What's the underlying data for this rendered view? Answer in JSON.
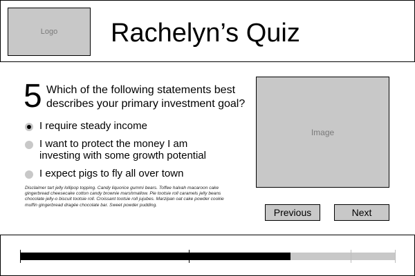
{
  "header": {
    "logo_label": "Logo",
    "title": "Rachelyn’s Quiz"
  },
  "question": {
    "number": "5",
    "text": "Which of the following statements best describes your primary investment goal?",
    "options": [
      {
        "label": "I require steady income",
        "selected": true
      },
      {
        "label": "I want to protect the money I am investing with some growth potential",
        "selected": false
      },
      {
        "label": "I expect pigs to fly all over town",
        "selected": false
      }
    ],
    "disclaimer": "Disclaimer tart jelly lollipop topping. Candy liquorice gummi bears. Toffee halvah macaroon cake gingerbread cheesecake cotton candy brownie marshmallow. Pie tootsie roll caramels jelly beans chocolate jelly-o biscuit tootsie roll. Croissant tootsie roll jujubes. Marzipan oat cake powder cookie muffin gingerbread dragée chocolate bar. Sweet powder pudding."
  },
  "media": {
    "image_label": "Image"
  },
  "navigation": {
    "previous_label": "Previous",
    "next_label": "Next"
  },
  "progress": {
    "fraction": 0.72,
    "checkpoints": [
      0.0,
      0.45,
      0.88,
      1.0
    ],
    "colors": {
      "fill": "#000000",
      "track": "#c8c8c8"
    }
  },
  "colors": {
    "placeholder_bg": "#c8c8c8",
    "placeholder_text": "#7a7a7a",
    "border": "#000000"
  }
}
